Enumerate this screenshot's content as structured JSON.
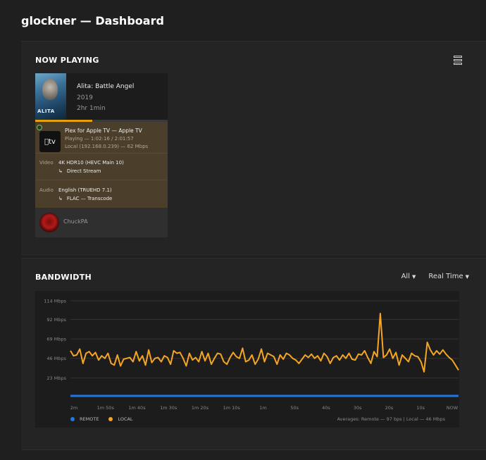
{
  "header": {
    "title": "glockner — Dashboard"
  },
  "now_playing": {
    "section_title": "NOW PLAYING",
    "view_icon": "list-view-icon",
    "media": {
      "poster_text": "ALITA",
      "title": "Alita: Battle Angel",
      "year": "2019",
      "duration": "2hr 1min",
      "progress": 0.43
    },
    "player": {
      "name": "Plex for Apple TV  —  Apple TV",
      "state": "Playing — 1:02:16 / 2:01:57",
      "network": "Local (192.168.0.239) — 62 Mbps",
      "icon_text": "tv"
    },
    "video": {
      "label": "Video",
      "main": "4K HDR10 (HEVC Main 10)",
      "sub": "Direct Stream"
    },
    "audio": {
      "label": "Audio",
      "main": "English (TRUEHD 7.1)",
      "sub": "FLAC — Transcode"
    },
    "user": {
      "name": "ChuckPA"
    }
  },
  "bandwidth": {
    "section_title": "BANDWIDTH",
    "filter": "All",
    "range": "Real Time",
    "legend": {
      "remote": "REMOTE",
      "local": "LOCAL"
    },
    "averages": "Averages: Remote — 97 bps | Local — 46 Mbps",
    "colors": {
      "remote": "#1f78e4",
      "local": "#f5a524",
      "grid": "#333333"
    }
  },
  "chart_data": {
    "type": "line",
    "y_ticks": [
      "114 Mbps",
      "92 Mbps",
      "69 Mbps",
      "46 Mbps",
      "23 Mbps"
    ],
    "y_tick_values": [
      114,
      92,
      69,
      46,
      23
    ],
    "ylim": [
      0,
      114
    ],
    "x_ticks": [
      "2m",
      "1m 50s",
      "1m 40s",
      "1m 30s",
      "1m 20s",
      "1m 10s",
      "1m",
      "50s",
      "40s",
      "30s",
      "20s",
      "10s",
      "NOW"
    ],
    "series": [
      {
        "name": "LOCAL",
        "color": "#f5a524",
        "values": [
          55,
          49,
          50,
          57,
          40,
          52,
          54,
          49,
          53,
          44,
          49,
          46,
          52,
          40,
          38,
          50,
          37,
          45,
          46,
          47,
          42,
          54,
          43,
          49,
          38,
          56,
          41,
          46,
          47,
          42,
          49,
          47,
          39,
          55,
          52,
          53,
          46,
          37,
          52,
          44,
          47,
          42,
          54,
          43,
          52,
          39,
          46,
          52,
          51,
          42,
          39,
          47,
          53,
          48,
          46,
          58,
          42,
          44,
          50,
          39,
          45,
          57,
          42,
          52,
          50,
          48,
          39,
          50,
          45,
          52,
          50,
          46,
          44,
          40,
          45,
          50,
          47,
          51,
          46,
          49,
          43,
          52,
          48,
          40,
          47,
          49,
          44,
          50,
          46,
          52,
          45,
          44,
          51,
          50,
          55,
          47,
          40,
          54,
          48,
          99,
          47,
          50,
          57,
          46,
          53,
          38,
          50,
          46,
          42,
          52,
          49,
          48,
          42,
          30,
          65,
          56,
          50,
          55,
          51,
          56,
          51,
          47,
          44,
          38,
          32
        ]
      },
      {
        "name": "REMOTE",
        "color": "#1f78e4",
        "constant": 0
      }
    ]
  }
}
